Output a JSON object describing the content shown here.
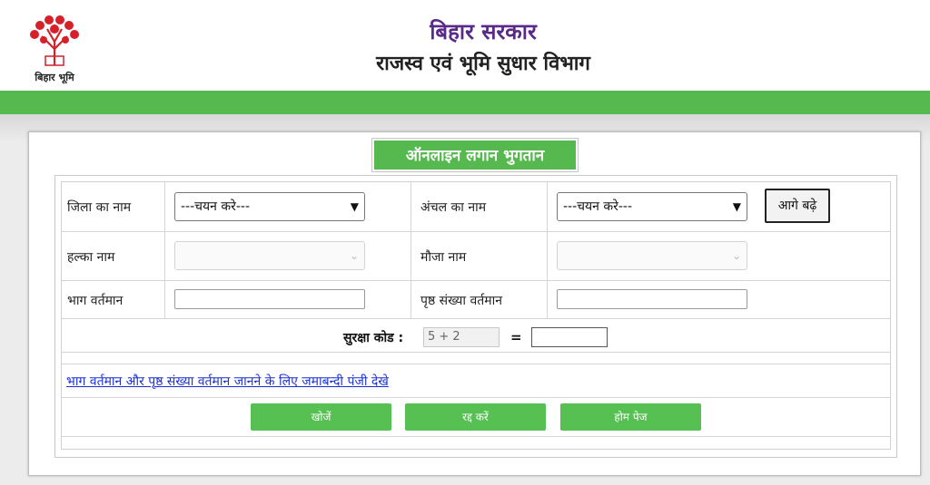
{
  "header": {
    "logo_text": "बिहार भूमि",
    "title_line1": "बिहार सरकार",
    "title_line2": "राजस्व एवं भूमि सुधार विभाग"
  },
  "panel": {
    "title": "ऑनलाइन लगान भुगतान"
  },
  "form": {
    "district_label": "जिला का नाम",
    "district_value": "---चयन करे---",
    "circle_label": "अंचल का नाम",
    "circle_value": "---चयन करे---",
    "next_button": "आगे बढ़े",
    "halka_label": "हल्का नाम",
    "mauja_label": "मौजा नाम",
    "bhag_label": "भाग वर्तमान",
    "page_label": "पृष्ठ संख्या वर्तमान",
    "captcha_label": "सुरक्षा कोड :",
    "captcha_value": "5 + 2",
    "equals": "="
  },
  "link_text": "भाग वर्तमान और पृष्ठ संख्या वर्तमान जानने के लिए जमाबन्दी पंजी देखे",
  "buttons": {
    "search": "खोजें",
    "cancel": "रद्द करें",
    "home": "होम पेज"
  },
  "colors": {
    "accent_green": "#56b94f",
    "title_purple": "#5a2a8a",
    "link_blue": "#1a2fd6"
  }
}
